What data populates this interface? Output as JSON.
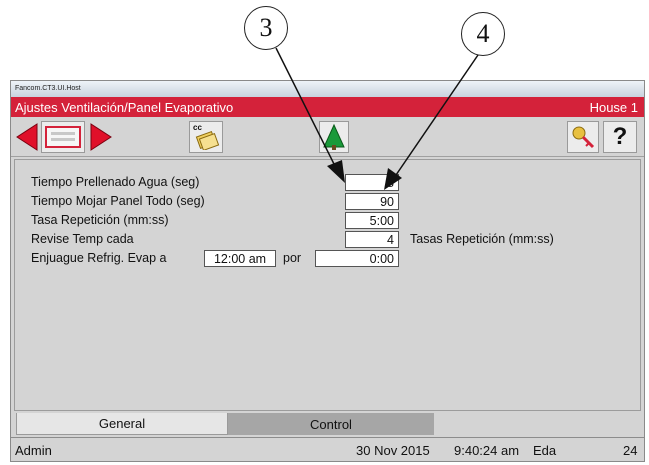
{
  "callouts": [
    "3",
    "4"
  ],
  "window": {
    "title": "Fancom.CT3.UI.Host",
    "header_title": "Ajustes Ventilación/Panel Evaporativo",
    "house": "House 1"
  },
  "toolbar": {
    "cc_label": "cc",
    "help_label": "?"
  },
  "settings": {
    "fill_time_label": "Tiempo Prellenado Agua (seg)",
    "fill_time_value": "8",
    "wet_panel_label": "Tiempo Mojar Panel Todo (seg)",
    "wet_panel_value": "90",
    "repeat_rate_label": "Tasa Repetición (mm:ss)",
    "repeat_rate_value": "5:00",
    "check_temp_label": "Revise Temp cada",
    "check_temp_value": "4",
    "check_temp_suffix": "Tasas Repetición (mm:ss)",
    "flush_label": "Enjuague Refrig. Evap a",
    "flush_time": "12:00 am",
    "flush_por": "por",
    "flush_duration": "0:00"
  },
  "tabs": [
    "General",
    "Control"
  ],
  "status": {
    "user": "Admin",
    "date": "30 Nov 2015",
    "time": "9:40:24 am",
    "eda_label": "Eda",
    "eda_value": "24"
  },
  "colors": {
    "header_red": "#d4223a",
    "arrow_red": "#e0102a",
    "tree_green": "#1a9a3a"
  }
}
